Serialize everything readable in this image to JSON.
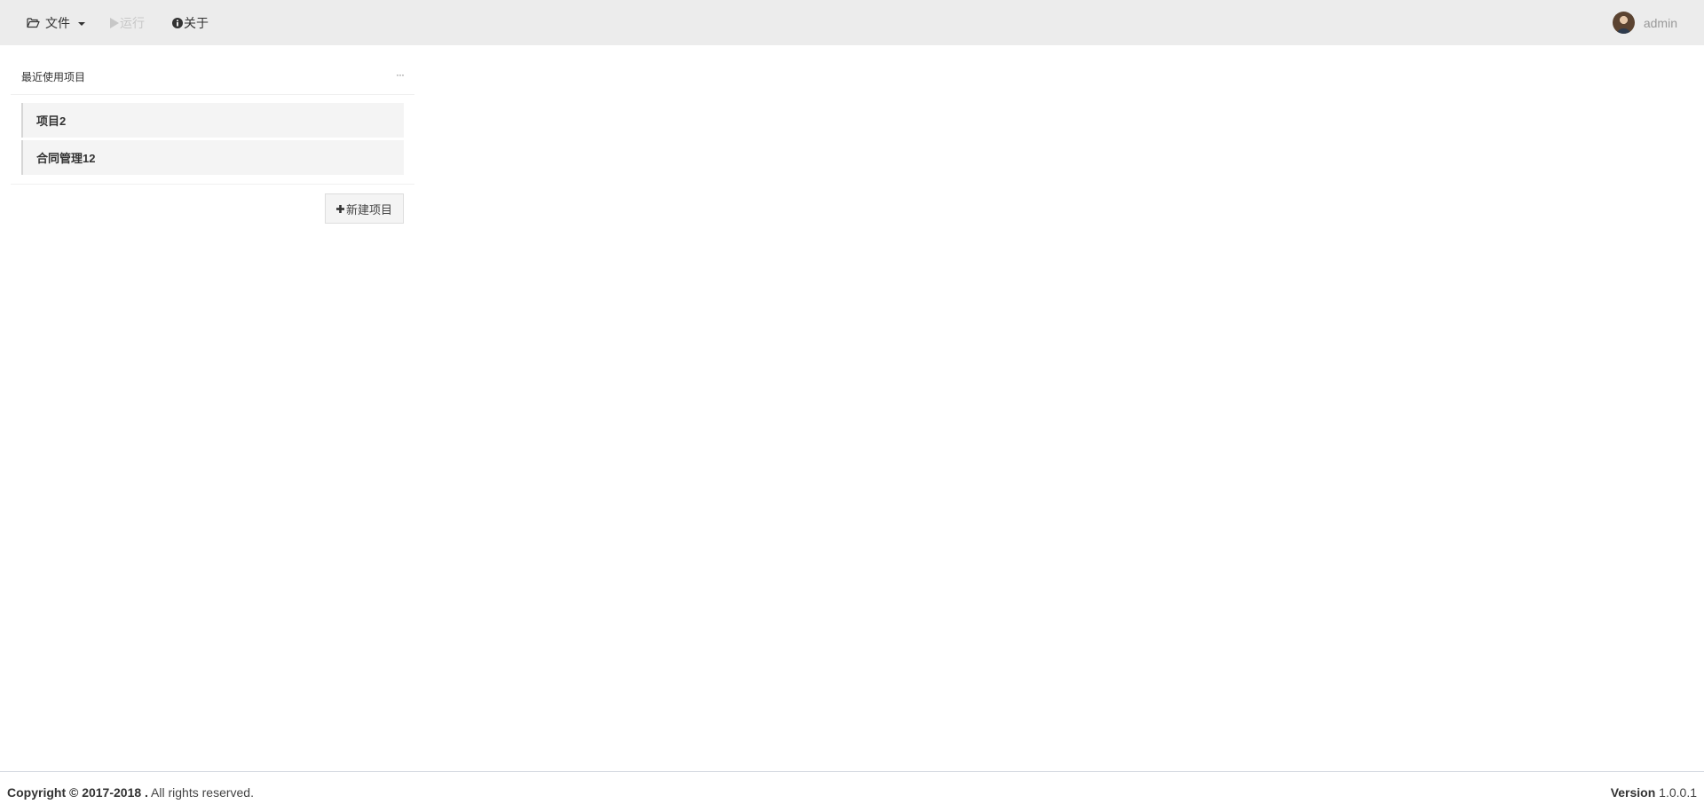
{
  "menu": {
    "file_label": "文件",
    "run_label": "运行",
    "about_label": "关于"
  },
  "user": {
    "name": "admin"
  },
  "panel": {
    "title": "最近使用项目",
    "more_label": "···",
    "items": [
      {
        "label": "项目2"
      },
      {
        "label": "合同管理12"
      }
    ],
    "new_button_label": "新建项目"
  },
  "footer": {
    "copyright_bold": "Copyright © 2017-2018 .",
    "copyright_rest": " All rights reserved.",
    "version_label": "Version",
    "version_value": " 1.0.0.1"
  },
  "colors": {
    "topbar": "#ececec",
    "disabled": "#c7c7c7",
    "list_bg": "#f4f4f4"
  }
}
